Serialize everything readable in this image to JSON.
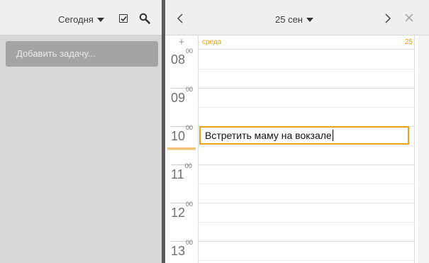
{
  "tasks_panel": {
    "filter_label": "Сегодня",
    "add_task_placeholder": "Добавить задачу..."
  },
  "calendar": {
    "date_label": "25 сен",
    "day_name": "среда",
    "day_number": "25",
    "hours": [
      {
        "h": "08",
        "m": "00"
      },
      {
        "h": "09",
        "m": "00"
      },
      {
        "h": "10",
        "m": "00"
      },
      {
        "h": "11",
        "m": "00"
      },
      {
        "h": "12",
        "m": "00"
      },
      {
        "h": "13",
        "m": "00"
      }
    ],
    "event_text": "Встретить маму на вокзале"
  },
  "colors": {
    "accent": "#e8a317",
    "task_input_bg": "#a4a4a4"
  },
  "icons": [
    "checkbox-icon",
    "search-icon",
    "chevron-left-icon",
    "chevron-right-icon",
    "close-icon",
    "plus-icon"
  ]
}
